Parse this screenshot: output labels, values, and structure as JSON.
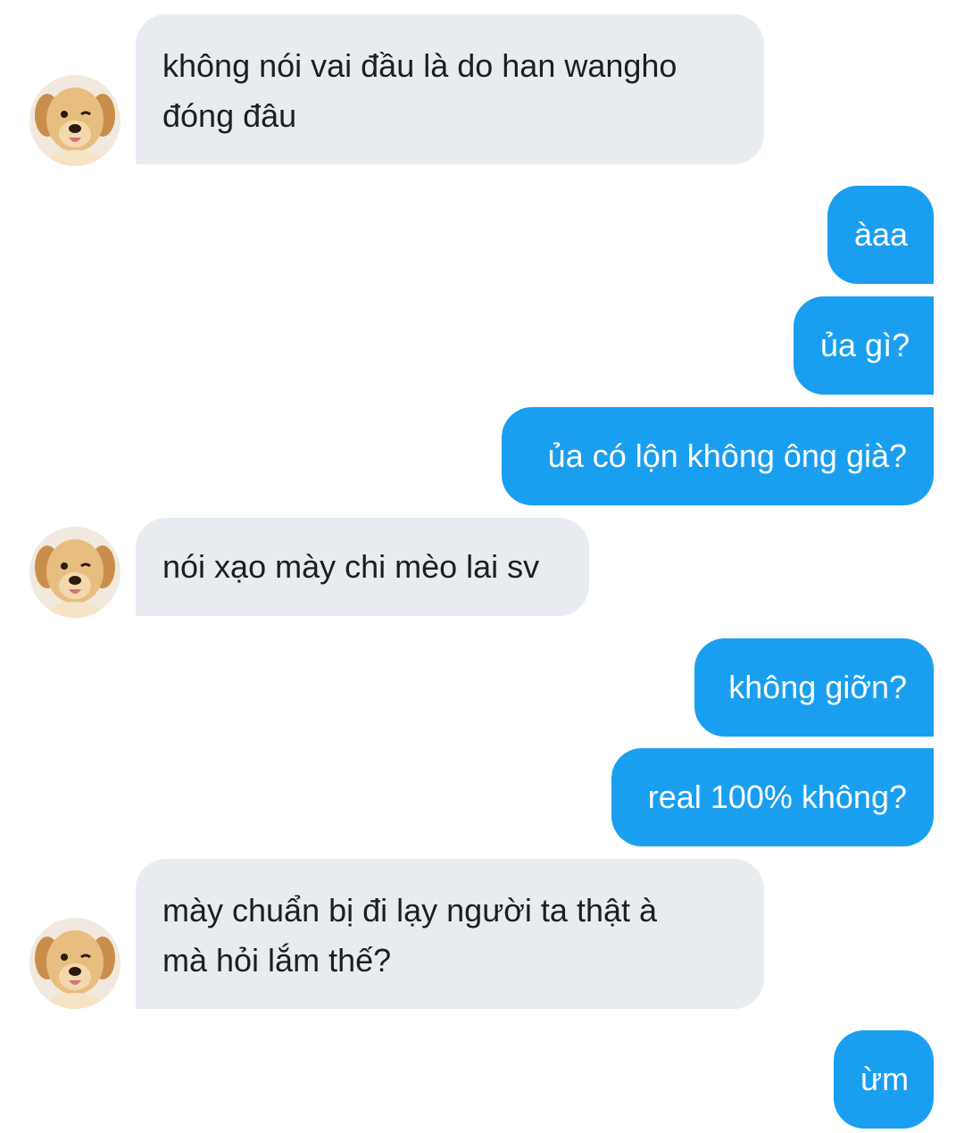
{
  "messages": [
    {
      "sender": "other",
      "lines": [
        "không nói vai đầu là do han wangho",
        "đóng đâu"
      ]
    },
    {
      "sender": "me",
      "text": "àaa"
    },
    {
      "sender": "me",
      "text": "ủa gì?"
    },
    {
      "sender": "me",
      "text": "ủa có lộn không ông già?"
    },
    {
      "sender": "other",
      "lines": [
        "nói xạo mày chi mèo lai sv"
      ]
    },
    {
      "sender": "me",
      "text": "không giỡn?"
    },
    {
      "sender": "me",
      "text": "real 100% không?"
    },
    {
      "sender": "other",
      "lines": [
        "mày chuẩn bị đi lạy người ta thật à",
        "mà hỏi lắm thế?"
      ]
    },
    {
      "sender": "me",
      "text": "ừm"
    }
  ],
  "colors": {
    "incoming_bubble": "#e8ecf0",
    "outgoing_bubble": "#1a9ff0",
    "outgoing_text": "#ffffff",
    "incoming_text": "#1c1e21"
  },
  "icons": {
    "avatar": "golden-retriever-puppy-avatar"
  }
}
